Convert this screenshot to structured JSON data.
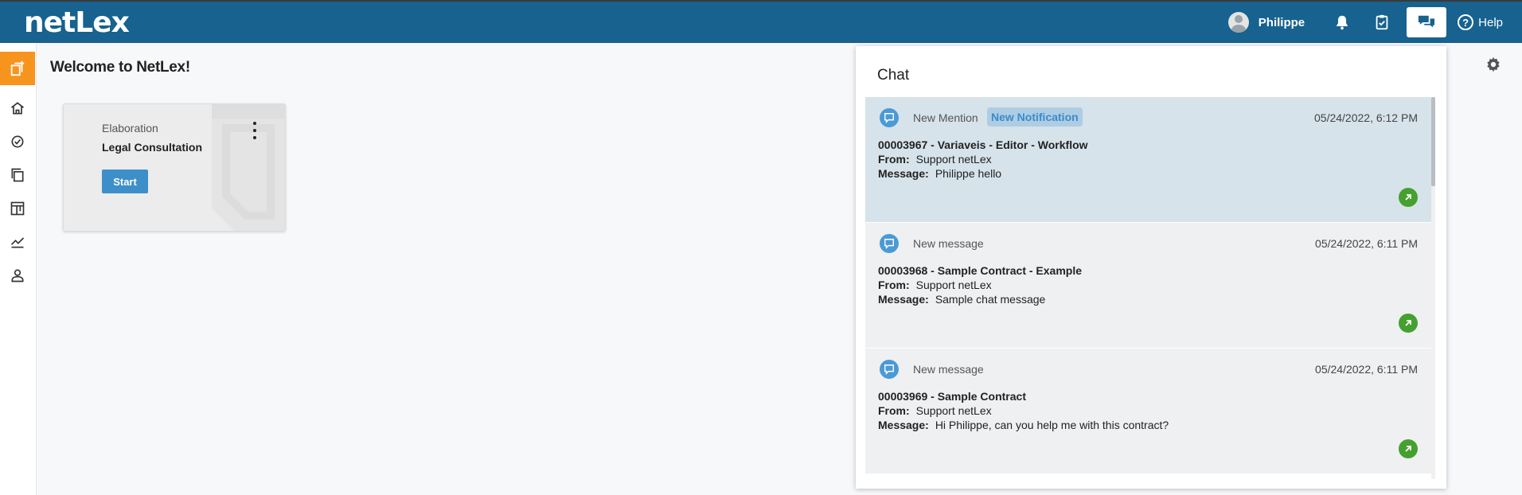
{
  "app": {
    "logo": "netLex",
    "user_name": "Philippe",
    "help_label": "Help"
  },
  "main": {
    "welcome": "Welcome to NetLex!"
  },
  "card": {
    "type_label": "Elaboration",
    "name": "Legal Consultation",
    "start_label": "Start"
  },
  "chat": {
    "title": "Chat",
    "messages": [
      {
        "kind": "New Mention",
        "badge": "New Notification",
        "date": "05/24/2022, 6:12 PM",
        "subject": "00003967 - Variaveis - Editor - Workflow",
        "from_label": "From:",
        "from": "Support netLex",
        "message_label": "Message:",
        "message": "Philippe  hello"
      },
      {
        "kind": "New message",
        "date": "05/24/2022, 6:11 PM",
        "subject": "00003968 - Sample Contract - Example",
        "from_label": "From:",
        "from": "Support netLex",
        "message_label": "Message:",
        "message": "Sample chat message"
      },
      {
        "kind": "New message",
        "date": "05/24/2022, 6:11 PM",
        "subject": "00003969 - Sample Contract",
        "from_label": "From:",
        "from": "Support netLex",
        "message_label": "Message:",
        "message": "Hi Philippe, can you help me with this contract?"
      }
    ]
  },
  "colors": {
    "topbar": "#17628f",
    "accent_orange": "#f7941d",
    "button_blue": "#3d8fca",
    "go_green": "#46a030",
    "highlight": "#d6e3ea"
  }
}
